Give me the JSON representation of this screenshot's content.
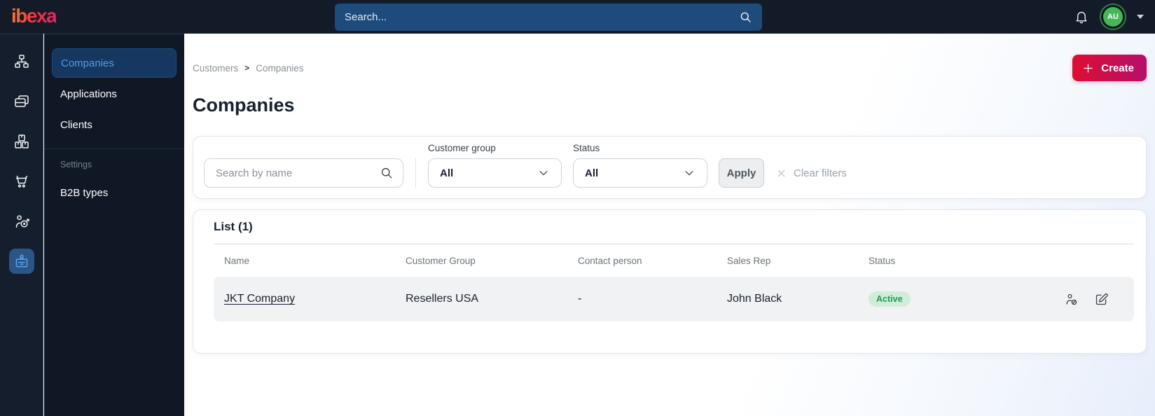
{
  "brand": {
    "logo_text": "ibexa"
  },
  "topbar": {
    "search_placeholder": "Search...",
    "avatar_initials": "AU"
  },
  "sidebar": {
    "rail_icons": [
      {
        "name": "sitemap-icon",
        "active": false
      },
      {
        "name": "pages-icon",
        "active": false
      },
      {
        "name": "products-icon",
        "active": false
      },
      {
        "name": "cart-icon",
        "active": false
      },
      {
        "name": "marketing-target-icon",
        "active": false
      },
      {
        "name": "customer-portal-icon",
        "active": true
      }
    ],
    "menu": {
      "items": [
        {
          "label": "Companies",
          "active": true
        },
        {
          "label": "Applications",
          "active": false
        },
        {
          "label": "Clients",
          "active": false
        }
      ],
      "section_label": "Settings",
      "section_items": [
        {
          "label": "B2B types"
        }
      ]
    }
  },
  "breadcrumb": {
    "items": [
      "Customers",
      "Companies"
    ],
    "separator": ">"
  },
  "page": {
    "title": "Companies"
  },
  "toolbar": {
    "create_label": "Create"
  },
  "filters": {
    "search_placeholder": "Search by name",
    "customer_group": {
      "label": "Customer group",
      "value": "All"
    },
    "status": {
      "label": "Status",
      "value": "All"
    },
    "apply_label": "Apply",
    "clear_label": "Clear filters"
  },
  "list": {
    "title": "List (1)",
    "columns": [
      "Name",
      "Customer Group",
      "Contact person",
      "Sales Rep",
      "Status"
    ],
    "rows": [
      {
        "name": "JKT Company",
        "customer_group": "Resellers USA",
        "contact_person": "-",
        "sales_rep": "John Black",
        "status": "Active"
      }
    ]
  },
  "colors": {
    "topbar_bg": "#131b29",
    "search_bg": "#1d4b7c",
    "active_text": "#4f9ee8",
    "active_pill_bg": "#16375f",
    "accent_gradient_start": "#dd0e33",
    "accent_gradient_end": "#b60f6a",
    "badge_bg": "#d0edda",
    "badge_text": "#1d9d50",
    "avatar_bg": "#46b656"
  }
}
